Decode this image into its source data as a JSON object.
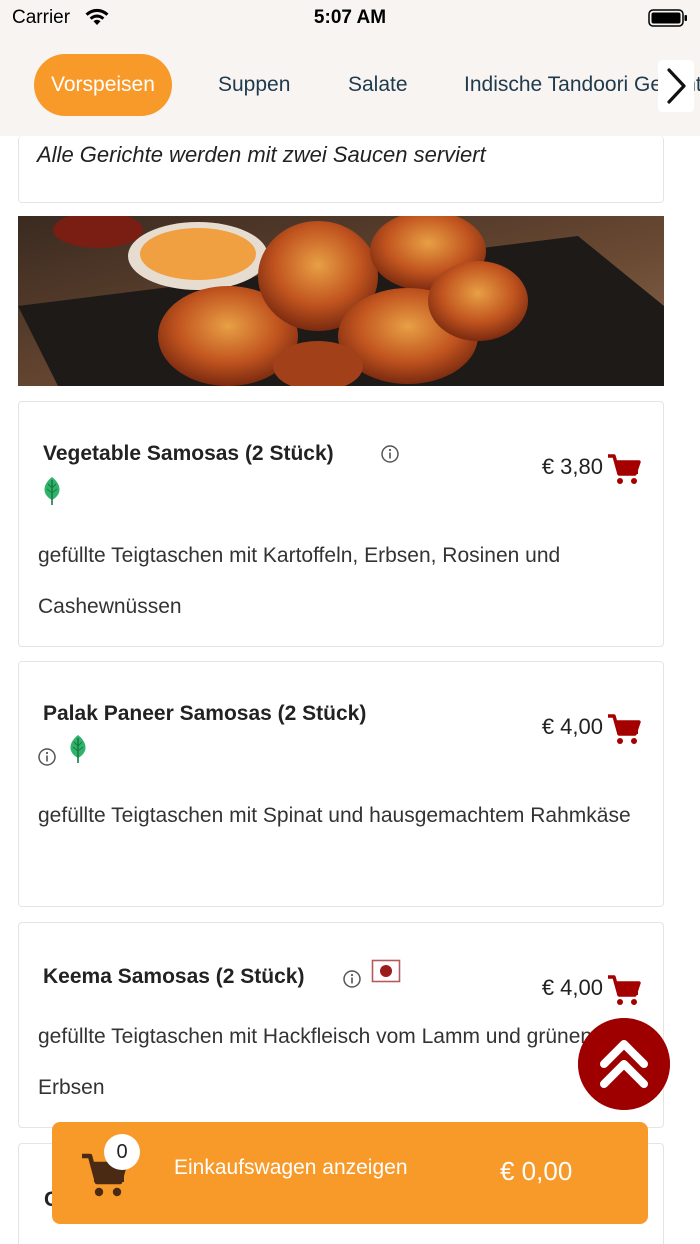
{
  "status_bar": {
    "carrier": "Carrier",
    "time": "5:07 AM"
  },
  "categories": [
    {
      "label": "Vorspeisen",
      "active": true
    },
    {
      "label": "Suppen",
      "active": false
    },
    {
      "label": "Salate",
      "active": false
    },
    {
      "label": "Indische Tandoori Gerichte",
      "active": false
    }
  ],
  "section_note": "Alle Gerichte werden mit zwei Saucen serviert",
  "items": [
    {
      "name": "Vegetable Samosas (2 Stück)",
      "price": "€ 3,80",
      "description": "gefüllte Teigtaschen mit Kartoffeln, Erbsen, Rosinen und Cashewnüssen",
      "icons": [
        "info-icon",
        "vegetarian-leaf-icon"
      ]
    },
    {
      "name": "Palak Paneer Samosas (2 Stück)",
      "price": "€ 4,00",
      "description": "gefüllte Teigtaschen mit Spinat und hausgemachtem Rahmkäse",
      "icons": [
        "info-icon",
        "vegetarian-leaf-icon"
      ]
    },
    {
      "name": "Keema Samosas (2 Stück)",
      "price": "€ 4,00",
      "description": "gefüllte Teigtaschen mit Hackfleisch vom Lamm und grünen Erbsen",
      "icons": [
        "info-icon",
        "meat-icon"
      ]
    },
    {
      "name": "C",
      "price": "",
      "description": "",
      "icons": []
    }
  ],
  "cart": {
    "count": "0",
    "label": "Einkaufswagen anzeigen",
    "total": "€ 0,00"
  },
  "colors": {
    "accent_orange": "#f89a2a",
    "cart_red": "#9e0000",
    "nav_text": "#1f3a4d",
    "leaf_green": "#2fb36a"
  }
}
